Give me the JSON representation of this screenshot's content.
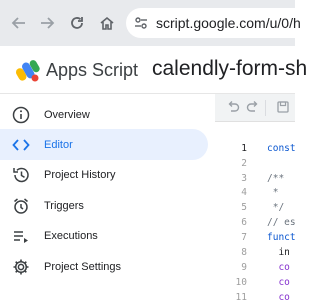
{
  "browser": {
    "url": "script.google.com/u/0/h"
  },
  "app": {
    "name": "Apps Script",
    "project_title": "calendly-form-sh"
  },
  "sidebar": {
    "items": [
      {
        "label": "Overview",
        "icon": "info-icon",
        "active": false
      },
      {
        "label": "Editor",
        "icon": "code-icon",
        "active": true
      },
      {
        "label": "Project History",
        "icon": "history-icon",
        "active": false
      },
      {
        "label": "Triggers",
        "icon": "alarm-icon",
        "active": false
      },
      {
        "label": "Executions",
        "icon": "executions-icon",
        "active": false
      },
      {
        "label": "Project Settings",
        "icon": "gear-icon",
        "active": false
      }
    ]
  },
  "editor": {
    "lines": [
      {
        "n": "1",
        "code": "const"
      },
      {
        "n": "2",
        "code": ""
      },
      {
        "n": "3",
        "code": "/**"
      },
      {
        "n": "4",
        "code": " *"
      },
      {
        "n": "5",
        "code": " */"
      },
      {
        "n": "6",
        "code": "// es"
      },
      {
        "n": "7",
        "code": "funct"
      },
      {
        "n": "8",
        "code": "  in"
      },
      {
        "n": "9",
        "code": "  co"
      },
      {
        "n": "10",
        "code": "  co"
      },
      {
        "n": "11",
        "code": "  co"
      }
    ]
  },
  "colors": {
    "accent": "#1a73e8",
    "active_bg": "#e8f0fe",
    "browser_bg": "#e8eaed"
  }
}
